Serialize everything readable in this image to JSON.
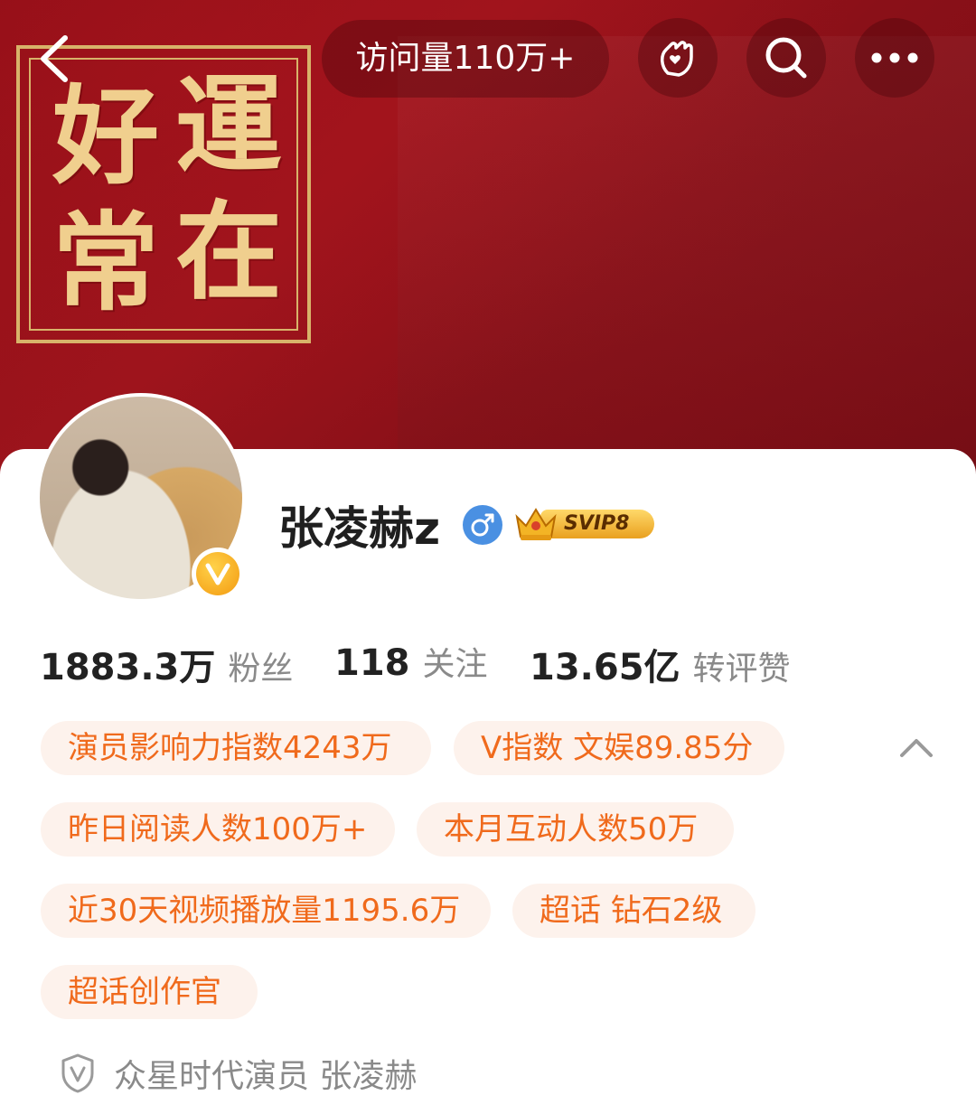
{
  "header": {
    "visits_label": "访问量110万+",
    "icons": [
      "back-arrow-icon",
      "hand-heart-icon",
      "search-icon",
      "more-icon"
    ]
  },
  "banner": {
    "seal_chars": [
      "運",
      "在",
      "好",
      "常"
    ],
    "colors": {
      "background": "#9d141c",
      "seal_gold": "#d8b36a"
    }
  },
  "profile": {
    "name": "张凌赫z",
    "gender_icon": "male-icon",
    "vip_label": "SVIP8",
    "verified_badge_icon": "verified-v-icon"
  },
  "stats": [
    {
      "value": "1883.3万",
      "label": "粉丝"
    },
    {
      "value": "118",
      "label": "关注"
    },
    {
      "value": "13.65亿",
      "label": "转评赞"
    }
  ],
  "tags": [
    "演员影响力指数4243万",
    "V指数 文娱89.85分",
    "昨日阅读人数100万+",
    "本月互动人数50万",
    "近30天视频播放量1195.6万",
    "超话 钻石2级",
    "超话创作官"
  ],
  "verification": {
    "icon": "shield-v-icon",
    "text": "众星时代演员 张凌赫"
  },
  "colors": {
    "tag_text": "#f06a1c",
    "tag_bg": "#fdf2ec",
    "gender_blue": "#4a90e2"
  }
}
